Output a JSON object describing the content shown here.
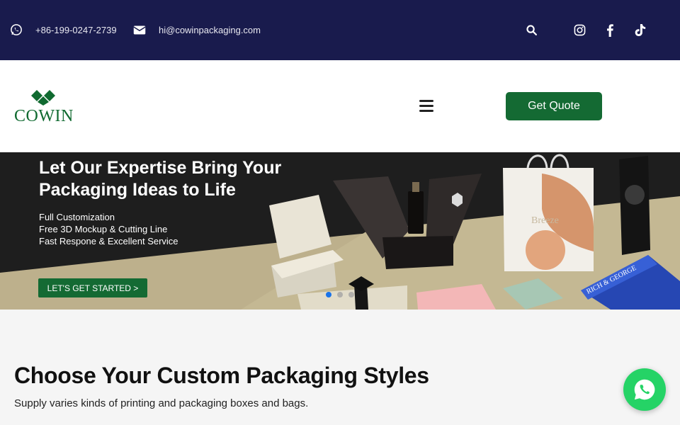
{
  "topbar": {
    "phone": "+86-199-0247-2739",
    "email": "hi@cowinpackaging.com",
    "icons": [
      "whatsapp-icon",
      "mail-icon",
      "search-icon",
      "instagram-icon",
      "facebook-icon",
      "tiktok-icon"
    ]
  },
  "header": {
    "logo_text": "COWIN",
    "quote_label": "Get Quote"
  },
  "hero": {
    "heading_line1": "Let Our Expertise Bring Your",
    "heading_line2": "Packaging Ideas to Life",
    "features": [
      "Full Customization",
      "Free 3D Mockup & Cutting Line",
      "Fast Respone & Excellent Service"
    ],
    "cta_label": "LET'S GET STARTED >",
    "bag_text": "Breeze",
    "box_text": "RICH & GEORGE",
    "slides": {
      "count": 3,
      "active": 1
    }
  },
  "section": {
    "title": "Choose Your Custom Packaging Styles",
    "subtitle": "Supply varies kinds of printing and packaging boxes and bags."
  },
  "colors": {
    "topbar_bg": "#191b4d",
    "brand_green": "#146a33",
    "dot_active": "#1a73e8",
    "whatsapp": "#25d366"
  }
}
